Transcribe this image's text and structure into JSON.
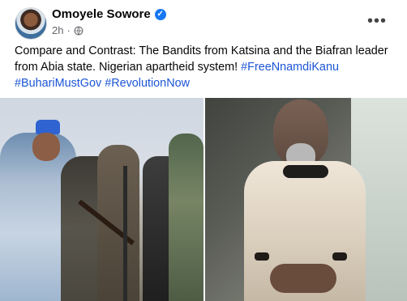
{
  "post": {
    "author_name": "Omoyele Sowore",
    "timestamp": "2h",
    "privacy_icon": "globe-icon",
    "verified_icon": "verified-badge-icon",
    "more_options_icon": "more-horizontal-icon",
    "text_prefix": "Compare and Contrast: The Bandits from Katsina and the Biafran leader from Abia state. Nigerian apartheid system!",
    "hashtags": [
      "#FreeNnamdiKanu",
      "#BuhariMustGov",
      "#RevolutionNow"
    ]
  },
  "colors": {
    "hashtag": "#1c55d6",
    "verified": "#1877f2",
    "meta": "#65676b"
  }
}
